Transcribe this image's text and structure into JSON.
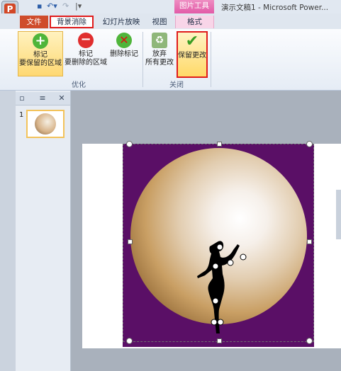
{
  "window": {
    "title": "演示文稿1 - Microsoft Power..."
  },
  "context_group": {
    "label": "图片工具"
  },
  "tabs": {
    "file": "文件",
    "background_removal": "背景消除",
    "slideshow": "幻灯片放映",
    "view": "视图",
    "format": "格式"
  },
  "ribbon": {
    "mark_keep": {
      "line1": "标记",
      "line2": "要保留的区域"
    },
    "mark_remove": {
      "line1": "标记",
      "line2": "要删除的区域"
    },
    "delete_mark": {
      "label": "删除标记"
    },
    "discard": {
      "line1": "放弃",
      "line2": "所有更改"
    },
    "keep_changes": {
      "label": "保留更改"
    },
    "group_refine": "优化",
    "group_close": "关闭"
  },
  "slides_panel": {
    "slide_number": "1"
  },
  "colors": {
    "accent_red": "#e01b1b",
    "purple_bg": "#5a0f66",
    "file_tab": "#cf4c2b"
  }
}
